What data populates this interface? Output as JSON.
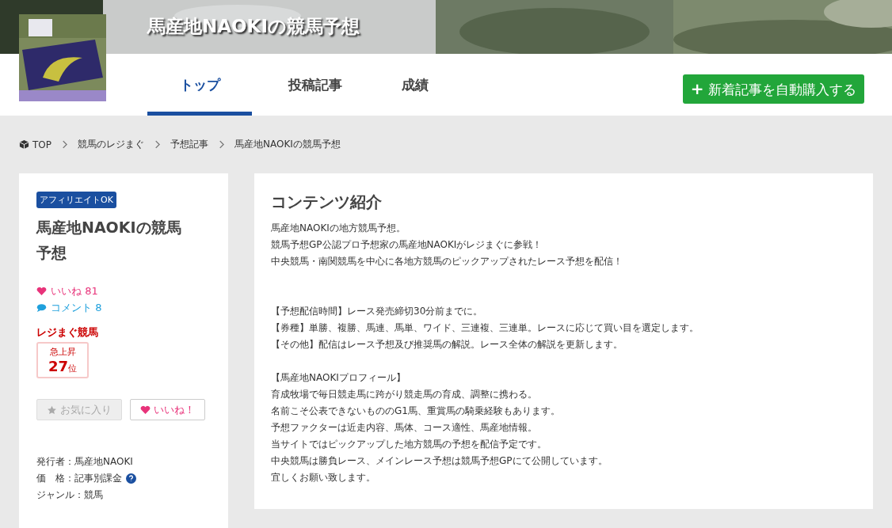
{
  "header": {
    "title": "馬産地NAOKIの競馬予想"
  },
  "tabs": [
    {
      "label": "トップ",
      "selected": true
    },
    {
      "label": "投稿記事",
      "selected": false
    },
    {
      "label": "成績",
      "selected": false
    }
  ],
  "auto_buy_button": {
    "icon": "+",
    "label": "新着記事を自動購入する"
  },
  "breadcrumb": [
    "TOP",
    "競馬のレジまぐ",
    "予想記事",
    "馬産地NAOKIの競馬予想"
  ],
  "profile": {
    "badge": "アフィリエイトOK",
    "title": "馬産地NAOKIの競馬予想",
    "likes": "いいね 81",
    "comments": "コメント 8",
    "ranking_label": "レジまぐ競馬",
    "rank_caption": "急上昇",
    "rank_number": "27",
    "rank_unit": "位",
    "buttons": [
      {
        "kind": "favorite",
        "label": "お気に入り",
        "disabled": true
      },
      {
        "kind": "like",
        "label": "いいね！",
        "disabled": false
      }
    ],
    "meta": [
      {
        "label": "発行者：馬産地NAOKI",
        "help": false
      },
      {
        "label": "価　格：記事別課金",
        "help": true
      },
      {
        "label": "ジャンル：競馬",
        "help": false
      }
    ]
  },
  "content": {
    "heading": "コンテンツ紹介",
    "paragraphs": [
      [
        "馬産地NAOKIの地方競馬予想。",
        "競馬予想GP公認プロ予想家の馬産地NAOKIがレジまぐに参戦！",
        "中央競馬・南関競馬を中心に各地方競馬のピックアップされたレース予想を配信！"
      ],
      [
        "【予想配信時間】レース発売締切30分前までに。",
        "【券種】単勝、複勝、馬連、馬単、ワイド、三連複、三連単。レースに応じて買い目を選定します。",
        "【その他】配信はレース予想及び推奨馬の解説。レース全体の解説を更新します。"
      ],
      [
        "【馬産地NAOKIプロフィール】",
        "育成牧場で毎日競走馬に跨がり競走馬の育成、調整に携わる。",
        "名前こそ公表できないもののG1馬、重賞馬の騎乗経験もあります。",
        "予想ファクターは近走内容、馬体、コース適性、馬産地情報。",
        "当サイトではピックアップした地方競馬の予想を配信予定です。",
        "中央競馬は勝負レース、メインレース予想は競馬予想GPにて公開しています。",
        "宜しくお願い致します。"
      ]
    ]
  }
}
